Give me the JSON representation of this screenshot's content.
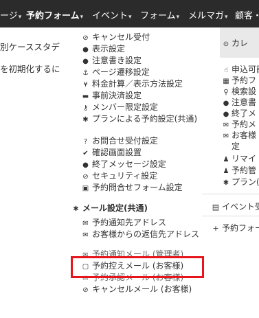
{
  "top_nav": {
    "items": [
      {
        "label": "ージ",
        "caret": "▾"
      },
      {
        "label": "予約フォーム",
        "caret": "▾"
      },
      {
        "label": "イベント",
        "caret": "▾"
      },
      {
        "label": "フォーム",
        "caret": "▾"
      },
      {
        "label": "メルマガ",
        "caret": "▾"
      },
      {
        "label": "顧客・",
        "caret": ""
      }
    ]
  },
  "left_snippets": [
    "別ケーススタデ",
    "を初期化するに"
  ],
  "menu": {
    "items": [
      {
        "icon": "⊘",
        "label": "キャンセル受付"
      },
      {
        "icon": "●",
        "label": "表示設定"
      },
      {
        "icon": "●",
        "label": "注意書き設定"
      },
      {
        "icon": "⚓",
        "label": "ページ遷移設定"
      },
      {
        "icon": "¥",
        "label": "料金計算／表示方法設定"
      },
      {
        "icon": "▬",
        "label": "事前決済設定"
      },
      {
        "icon": "⚷",
        "label": "メンバー限定設定"
      },
      {
        "icon": "✱",
        "label": "プランによる予約設定(共通)"
      },
      {
        "icon": "?",
        "label": "お問合せ受付設定"
      },
      {
        "icon": "✔",
        "label": "確認画面設置"
      },
      {
        "icon": "●",
        "label": "終了メッセージ設定"
      },
      {
        "icon": "⊘",
        "label": "セキュリティ設定"
      },
      {
        "icon": "▣",
        "label": "予約問合せフォーム設定"
      }
    ],
    "mail_section": {
      "header_icon": "✱",
      "header": "メール設定(共通)",
      "items": [
        {
          "icon": "✉",
          "label": "予約通知先アドレス"
        },
        {
          "icon": "✉",
          "label": "お客様からの返信先アドレス"
        },
        {
          "icon": "✉",
          "label": "予約通知メール (管理者)"
        },
        {
          "icon": "▢",
          "label": "予約控えメール (お客様)"
        },
        {
          "icon": "✉",
          "label": "予約承認メール (お客様)"
        },
        {
          "icon": "⊘",
          "label": "キャンセルメール (お客様)"
        }
      ]
    }
  },
  "right_panel": {
    "top_item": {
      "icon": "⊙",
      "label": "カレ"
    },
    "items": [
      {
        "icon": "☝",
        "label": "申込可能"
      },
      {
        "icon": "▦",
        "label": "予約フ"
      },
      {
        "icon": "⚲",
        "label": "検索設"
      },
      {
        "icon": "●",
        "label": "注意書"
      },
      {
        "icon": "●",
        "label": "終了メ"
      },
      {
        "icon": "✉",
        "label": "予約メ"
      },
      {
        "icon": "✉",
        "label": "お客様"
      },
      {
        "icon": "",
        "label": "定"
      },
      {
        "icon": "♟",
        "label": "リマイ"
      },
      {
        "icon": "♟",
        "label": "予約管"
      },
      {
        "icon": "✱",
        "label": "プラン("
      }
    ],
    "sub_items": [
      {
        "icon": "▤",
        "label": "イベント受"
      },
      {
        "icon": "+",
        "label": "予約フォー"
      }
    ]
  }
}
